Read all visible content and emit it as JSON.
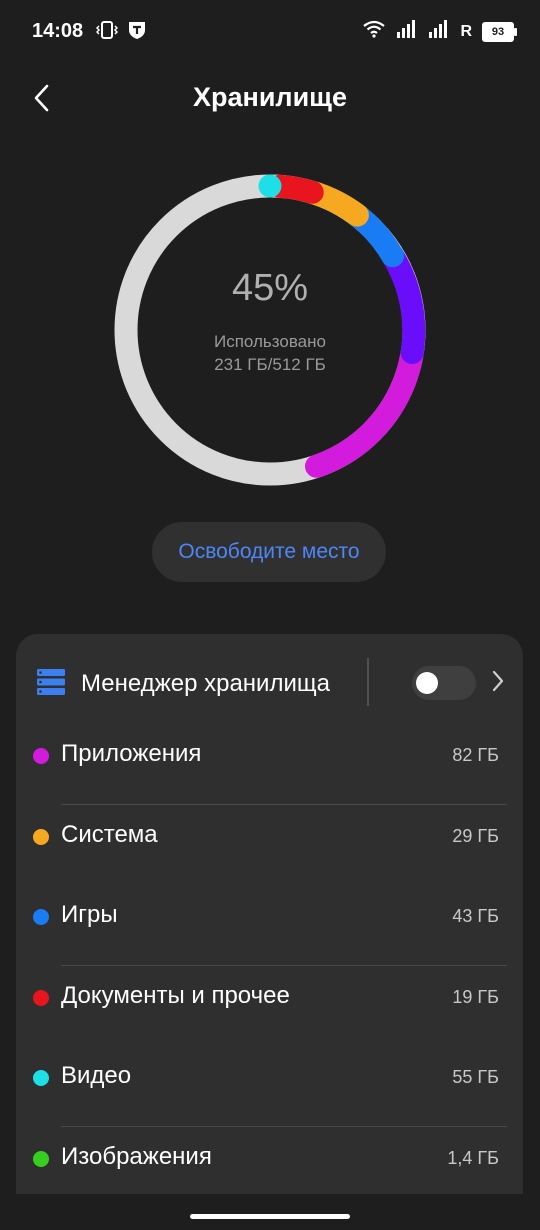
{
  "status": {
    "time": "14:08",
    "carrier_label": "R",
    "battery": "93"
  },
  "header": {
    "title": "Хранилище"
  },
  "storage": {
    "percent_text": "45%",
    "used_label": "Использовано",
    "used_amount": "231 ГБ/512 ГБ",
    "used_fraction": 0.45
  },
  "free_button": {
    "label": "Освободите место"
  },
  "manager": {
    "label": "Менеджер хранилища",
    "enabled": false
  },
  "categories": [
    {
      "label": "Приложения",
      "size": "82 ГБ",
      "color": "#d21bdc"
    },
    {
      "label": "Система",
      "size": "29 ГБ",
      "color": "#f6a821"
    },
    {
      "label": "Игры",
      "size": "43 ГБ",
      "color": "#1a7cf4"
    },
    {
      "label": "Документы и прочее",
      "size": "19 ГБ",
      "color": "#e8141e"
    },
    {
      "label": "Видео",
      "size": "55 ГБ",
      "color": "#1de0e6"
    },
    {
      "label": "Изображения",
      "size": "1,4 ГБ",
      "color": "#35d01f"
    }
  ],
  "colors": {
    "accent": "#4d86f5",
    "donut_track": "#d9d9d9",
    "donut_violet": "#6a0dfa"
  }
}
